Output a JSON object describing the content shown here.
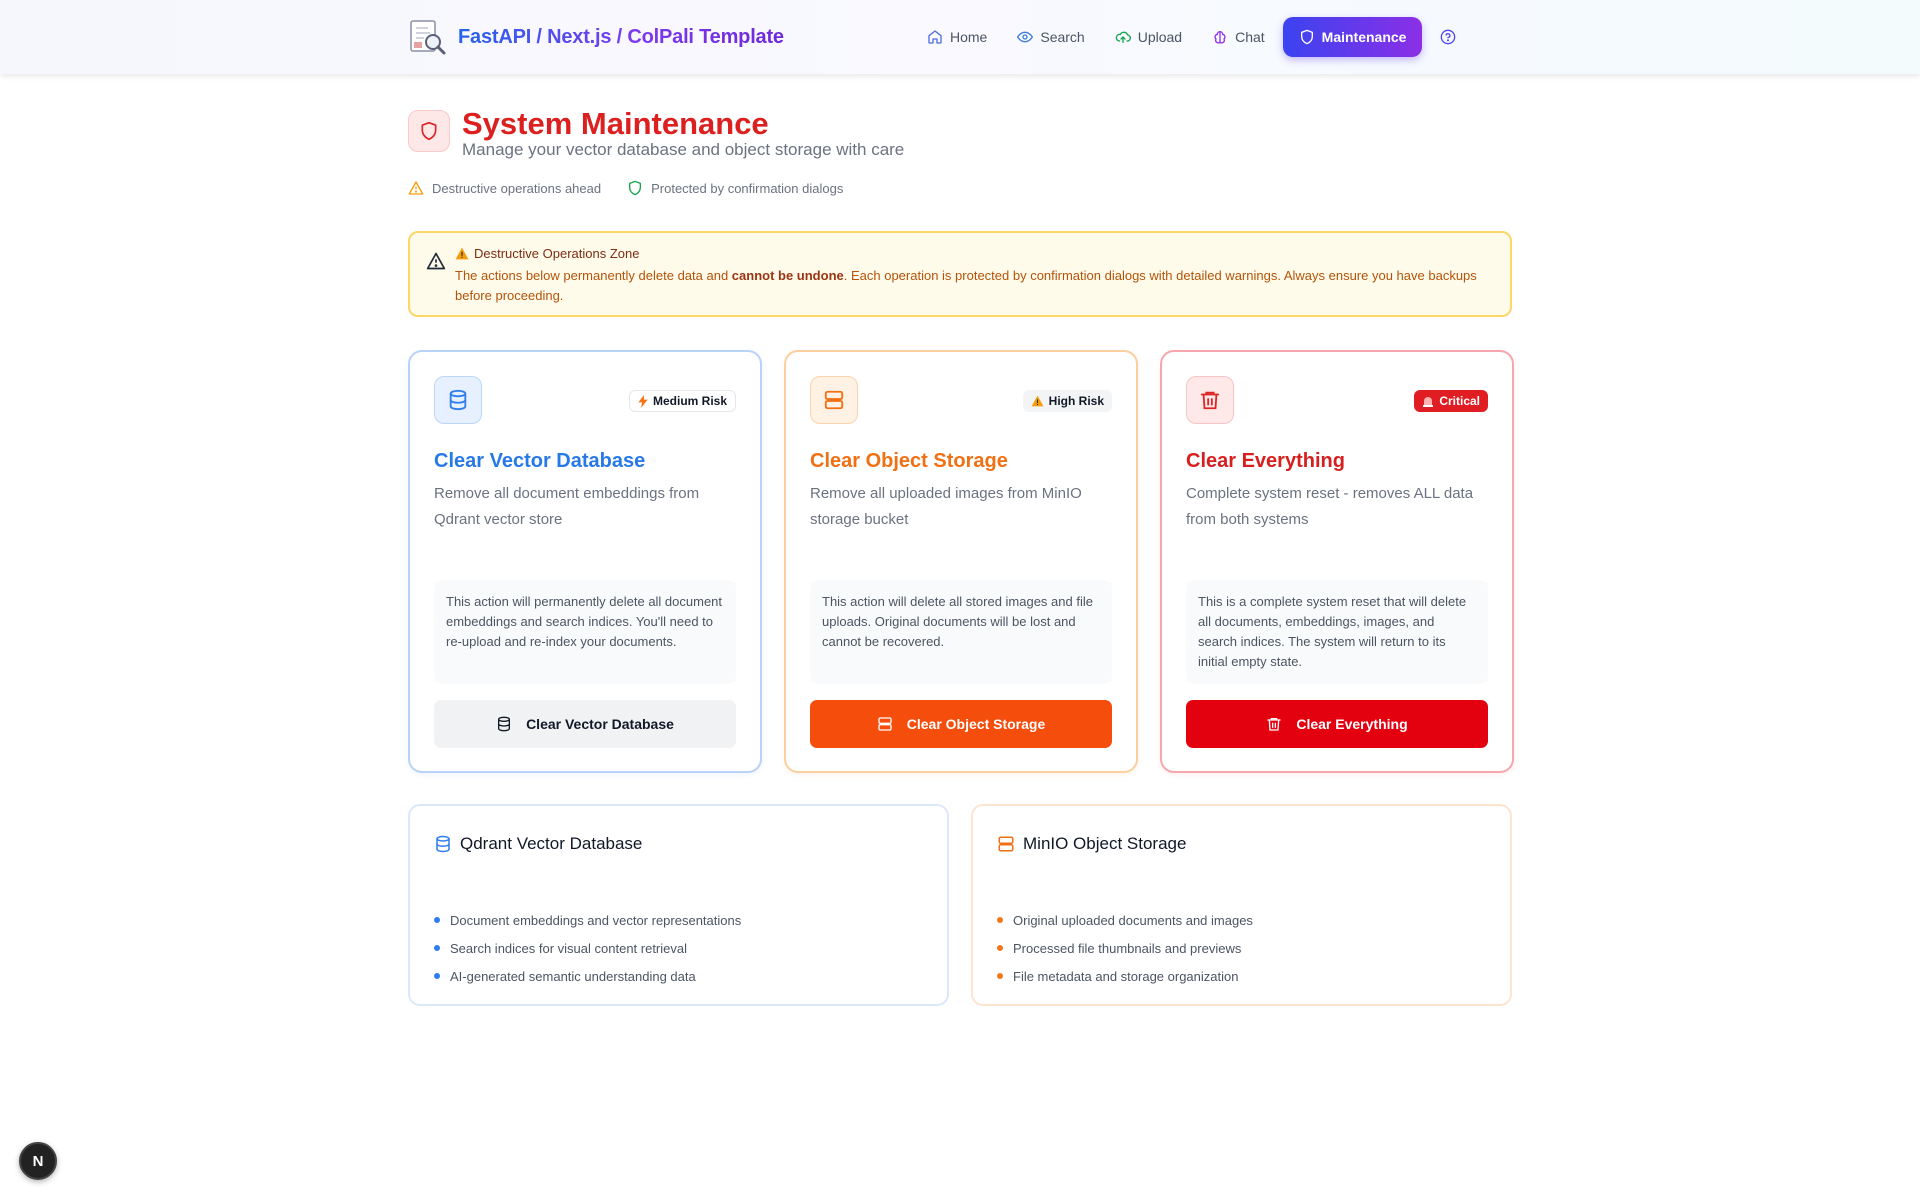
{
  "header": {
    "brand_title": "FastAPI / Next.js / ColPali Template",
    "nav": [
      {
        "label": "Home",
        "icon": "home-icon"
      },
      {
        "label": "Search",
        "icon": "eye-icon"
      },
      {
        "label": "Upload",
        "icon": "cloud-upload-icon"
      },
      {
        "label": "Chat",
        "icon": "brain-icon"
      },
      {
        "label": "Maintenance",
        "icon": "shield-icon",
        "active": true
      }
    ],
    "help_icon": "help-circle-icon"
  },
  "page": {
    "title": "System Maintenance",
    "subtitle": "Manage your vector database and object storage with care",
    "tags": [
      "Destructive operations ahead",
      "Protected by confirmation dialogs"
    ]
  },
  "warning": {
    "title": "Destructive Operations Zone",
    "text_before": "The actions below permanently delete data and ",
    "text_bold": "cannot be undone",
    "text_after": ". Each operation is protected by confirmation dialogs with detailed warnings. Always ensure you have backups before proceeding."
  },
  "cards": [
    {
      "badge": "Medium Risk",
      "title": "Clear Vector Database",
      "description": "Remove all document embeddings from Qdrant vector store",
      "note": "This action will permanently delete all document embeddings and search indices. You'll need to re-upload and re-index your documents.",
      "button": "Clear Vector Database",
      "accent": "#2879e8"
    },
    {
      "badge": "High Risk",
      "title": "Clear Object Storage",
      "description": "Remove all uploaded images from MinIO storage bucket",
      "note": "This action will delete all stored images and file uploads. Original documents will be lost and cannot be recovered.",
      "button": "Clear Object Storage",
      "accent": "#f44d0c"
    },
    {
      "badge": "Critical",
      "title": "Clear Everything",
      "description": "Complete system reset - removes ALL data from both systems",
      "note": "This is a complete system reset that will delete all documents, embeddings, images, and search indices. The system will return to its initial empty state.",
      "button": "Clear Everything",
      "accent": "#e3000f"
    }
  ],
  "panels": [
    {
      "title": "Qdrant Vector Database",
      "items": [
        "Document embeddings and vector representations",
        "Search indices for visual content retrieval",
        "AI-generated semantic understanding data"
      ]
    },
    {
      "title": "MinIO Object Storage",
      "items": [
        "Original uploaded documents and images",
        "Processed file thumbnails and previews",
        "File metadata and storage organization"
      ]
    }
  ],
  "next_badge": "N"
}
